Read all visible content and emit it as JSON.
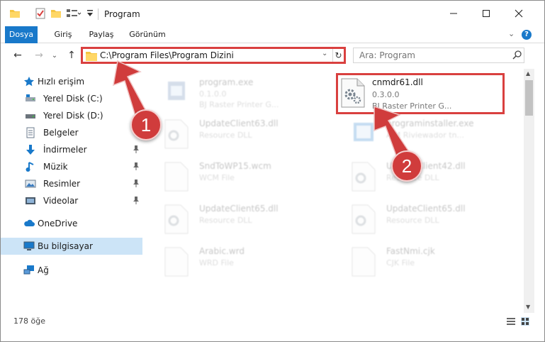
{
  "window": {
    "title": "Program",
    "controls": {
      "minimize": "—",
      "maximize": "☐",
      "close": "✕"
    }
  },
  "ribbon": {
    "tabs": [
      {
        "label": "Dosya",
        "active": true
      },
      {
        "label": "Giriş"
      },
      {
        "label": "Paylaş"
      },
      {
        "label": "Görünüm"
      }
    ],
    "expand": "⌄",
    "help": "?"
  },
  "nav": {
    "back": "←",
    "forward": "→",
    "recent": "⌄",
    "up": "↑",
    "path": "C:\\Program Files\\Program Dizini",
    "dropdown": "⌄",
    "refresh": "↻",
    "search_placeholder": "Ara: Program"
  },
  "sidebar": {
    "items": [
      {
        "label": "Hızlı erişim",
        "icon": "star-icon"
      },
      {
        "label": "Yerel Disk (C:)",
        "icon": "drive-icon",
        "pinned": true
      },
      {
        "label": "Yerel Disk (D:)",
        "icon": "drive-icon",
        "pinned": true
      },
      {
        "label": "Belgeler",
        "icon": "document-icon",
        "pinned": true
      },
      {
        "label": "İndirmeler",
        "icon": "download-icon",
        "pinned": true
      },
      {
        "label": "Müzik",
        "icon": "music-icon",
        "pinned": true
      },
      {
        "label": "Resimler",
        "icon": "picture-icon",
        "pinned": true
      },
      {
        "label": "Videolar",
        "icon": "video-icon",
        "pinned": true
      },
      {
        "label": "OneDrive",
        "icon": "cloud-icon"
      },
      {
        "label": "Bu bilgisayar",
        "icon": "computer-icon",
        "selected": true
      },
      {
        "label": "Ağ",
        "icon": "network-icon"
      }
    ],
    "pin_glyph": "📌"
  },
  "files": [
    {
      "name": "program.exe",
      "line1": "0.1.0.0",
      "line2": "BJ Raster Printer G...",
      "icon": "exe-icon"
    },
    {
      "name": "cnmdr61.dll",
      "line1": "0.3.0.0",
      "line2": "BJ Raster Printer G...",
      "icon": "dll-gear-icon",
      "highlight": true
    },
    {
      "name": "UpdateClient63.dll",
      "line1": "Resource DLL",
      "line2": "",
      "icon": "dll-gear-icon"
    },
    {
      "name": "programinstaller.exe",
      "line1": "AIM Riviewador tn...",
      "line2": "",
      "icon": "installer-icon"
    },
    {
      "name": "SndToWP15.wcm",
      "line1": "WCM File",
      "line2": "",
      "icon": "blank-file-icon"
    },
    {
      "name": "UpdateClient42.dll",
      "line1": "Resource DLL",
      "line2": "",
      "icon": "dll-gear-icon"
    },
    {
      "name": "UpdateClient65.dll",
      "line1": "Resource DLL",
      "line2": "",
      "icon": "dll-gear-icon"
    },
    {
      "name": "UpdateClient65.dll",
      "line1": "Resource DLL",
      "line2": "",
      "icon": "dll-gear-icon"
    },
    {
      "name": "Arabic.wrd",
      "line1": "WRD File",
      "line2": "",
      "icon": "blank-file-icon"
    },
    {
      "name": "FastNmi.cjk",
      "line1": "CJK File",
      "line2": "",
      "icon": "blank-file-icon"
    }
  ],
  "status": {
    "count": "178 öğe"
  },
  "annotations": [
    {
      "number": "1"
    },
    {
      "number": "2"
    }
  ],
  "colors": {
    "accent": "#1979ca",
    "annotation": "#d03c3c",
    "selection": "#cce4f7"
  }
}
